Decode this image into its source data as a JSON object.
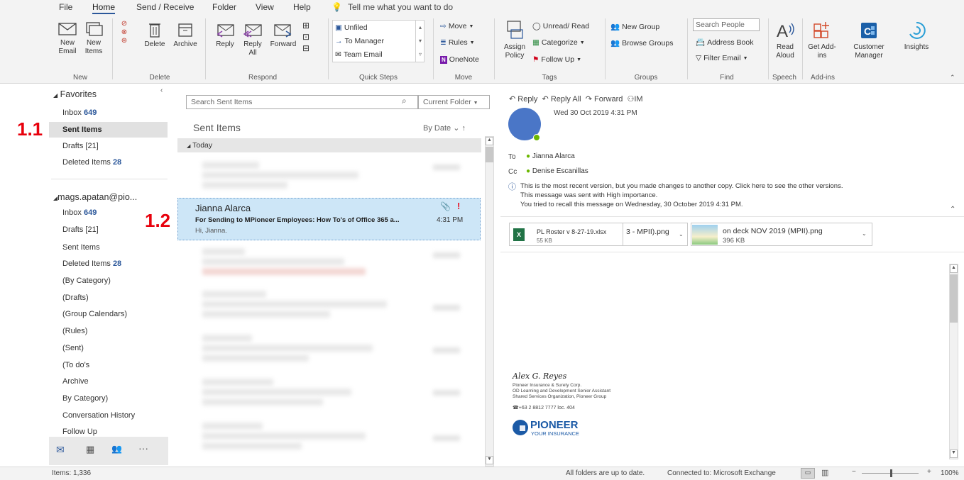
{
  "menu": [
    "File",
    "Home",
    "Send / Receive",
    "Folder",
    "View",
    "Help"
  ],
  "tell_me": "Tell me what you want to do",
  "ribbon": {
    "new_email": "New Email",
    "new_items": "New Items",
    "delete": "Delete",
    "archive": "Archive",
    "reply": "Reply",
    "reply_all": "Reply All",
    "forward": "Forward",
    "quick_steps": [
      "Unfiled",
      "To Manager",
      "Team Email"
    ],
    "move": "Move",
    "rules": "Rules",
    "onenote": "OneNote",
    "assign_policy": "Assign Policy",
    "unread_read": "Unread/ Read",
    "categorize": "Categorize",
    "follow_up": "Follow Up",
    "new_group": "New Group",
    "browse_groups": "Browse Groups",
    "search_people": "Search People",
    "address_book": "Address Book",
    "filter_email": "Filter Email",
    "read_aloud": "Read Aloud",
    "get_addins": "Get Add-ins",
    "customer_manager": "Customer Manager",
    "insights": "Insights",
    "groups": [
      "New",
      "Delete",
      "Respond",
      "Quick Steps",
      "Move",
      "Tags",
      "Groups",
      "Find",
      "Speech",
      "Add-ins"
    ]
  },
  "nav": {
    "favorites": "Favorites",
    "fav_items": [
      {
        "label": "Inbox",
        "count": "649"
      },
      {
        "label": "Sent Items",
        "count": ""
      },
      {
        "label": "Drafts [21]",
        "count": ""
      },
      {
        "label": "Deleted Items",
        "count": "28"
      }
    ],
    "account": "mags.apatan@pio...",
    "account_items": [
      {
        "label": "Inbox",
        "count": "649"
      },
      {
        "label": "Drafts [21]",
        "count": ""
      },
      {
        "label": "Sent Items",
        "count": ""
      },
      {
        "label": "Deleted Items",
        "count": "28"
      },
      {
        "label": "(By Category)",
        "count": ""
      },
      {
        "label": "(Drafts)",
        "count": ""
      },
      {
        "label": "(Group Calendars)",
        "count": ""
      },
      {
        "label": "(Rules)",
        "count": ""
      },
      {
        "label": "(Sent)",
        "count": ""
      },
      {
        "label": "(To do's",
        "count": ""
      },
      {
        "label": "Archive",
        "count": ""
      },
      {
        "label": "By Category)",
        "count": ""
      },
      {
        "label": "Conversation History",
        "count": ""
      },
      {
        "label": "Follow Up",
        "count": ""
      }
    ]
  },
  "list": {
    "search_placeholder": "Search Sent Items",
    "scope": "Current Folder",
    "title": "Sent Items",
    "sort": "By Date",
    "group_today": "Today",
    "selected": {
      "name": "Jianna Alarca",
      "subject": "For Sending to MPioneer Employees: How To's of Office 365 a...",
      "preview": "Hi, Jianna.",
      "time": "4:31 PM",
      "flag": "!"
    }
  },
  "reading": {
    "actions": [
      "Reply",
      "Reply All",
      "Forward",
      "IM"
    ],
    "date": "Wed 30 Oct 2019 4:31 PM",
    "to_label": "To",
    "to": "Jianna Alarca",
    "cc_label": "Cc",
    "cc": "Denise Escanillas",
    "info1": "This is the most recent version, but you made changes to another copy. Click here to see the other versions.",
    "info2": "This message was sent with High importance.",
    "info3": "You tried to recall this message on Wednesday, 30 October 2019 4:31 PM.",
    "attachments": [
      {
        "name": "PL Roster v 8-27-19.xlsx",
        "size": "55 KB"
      },
      {
        "name": "3 - MPII).png",
        "size": ""
      },
      {
        "name": "on deck NOV 2019 (MPII).png",
        "size": "396 KB"
      }
    ],
    "signature": {
      "name": "Alex G. Reyes",
      "line1": "Pioneer Insurance & Surety Corp.",
      "line2": "OD Learning and Development Senior Assistant",
      "line3": "Shared Services Organization, Pioneer Group",
      "phone": "+63 2 8812 7777 loc. 404",
      "brand": "PIONEER",
      "tagline": "YOUR INSURANCE"
    }
  },
  "status": {
    "items": "Items: 1,336",
    "uptodate": "All folders are up to date.",
    "connected": "Connected to: Microsoft Exchange",
    "zoom": "100%"
  },
  "annotations": [
    "1.1",
    "1.2"
  ]
}
